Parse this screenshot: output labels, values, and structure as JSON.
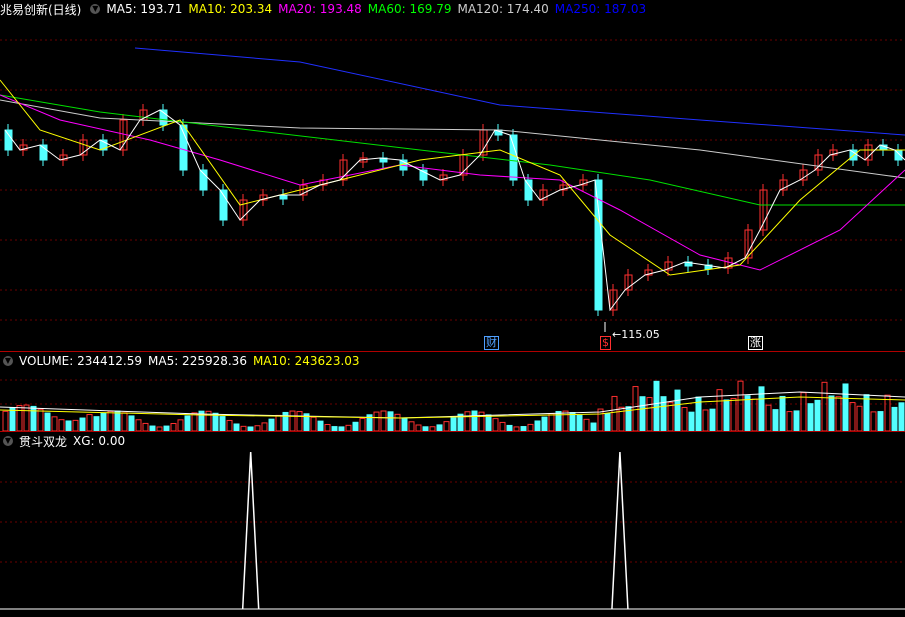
{
  "main": {
    "title": "兆易创新(日线)",
    "indicators": [
      {
        "label": "MA5: 193.71",
        "color": "#ffffff"
      },
      {
        "label": "MA10: 203.34",
        "color": "#ffff00"
      },
      {
        "label": "MA20: 193.48",
        "color": "#ff00ff"
      },
      {
        "label": "MA60: 169.79",
        "color": "#00ff00"
      },
      {
        "label": "MA120: 174.40",
        "color": "#cccccc"
      },
      {
        "label": "MA250: 187.03",
        "color": "#0000ff"
      }
    ],
    "low_label": "115.05",
    "markers": [
      {
        "text": "财",
        "color": "#4fa0ff",
        "fraction": 0.535
      },
      {
        "text": "$",
        "color": "#ff3030",
        "fraction": 0.663
      },
      {
        "text": "涨",
        "color": "#ffffff",
        "fraction": 0.827
      }
    ]
  },
  "volume": {
    "indicators": [
      {
        "label": "VOLUME: 234412.59",
        "color": "#ffffff"
      },
      {
        "label": "MA5: 225928.36",
        "color": "#ffffff"
      },
      {
        "label": "MA10: 243623.03",
        "color": "#ffff00"
      }
    ]
  },
  "signal": {
    "title": "贯斗双龙",
    "xg_label": "XG: 0.00",
    "peaks": [
      0.277,
      0.685
    ]
  },
  "colors": {
    "up": "#ff3030",
    "down": "#54ffff",
    "grid": "#6a0000"
  }
}
